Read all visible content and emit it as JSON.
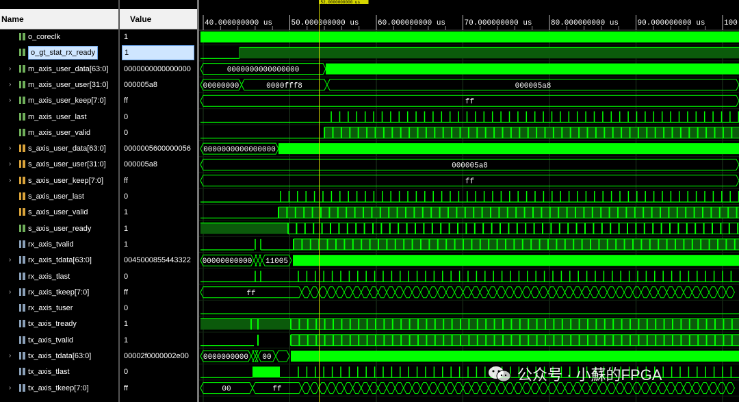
{
  "header": {
    "name_label": "Name",
    "value_label": "Value"
  },
  "cursor_label": "52.0000000000 us",
  "time_ticks": [
    "40.000000000 us",
    "50.000000000 us",
    "60.000000000 us",
    "70.000000000 us",
    "80.000000000 us",
    "90.000000000 us",
    "100."
  ],
  "signals": [
    {
      "name": "o_coreclk",
      "value": "1",
      "type": "bit",
      "expand": false
    },
    {
      "name": "o_gt_stat_rx_ready",
      "value": "1",
      "type": "bit",
      "expand": false,
      "selected": true
    },
    {
      "name": "m_axis_user_data[63:0]",
      "value": "0000000000000000",
      "type": "bus",
      "expand": true
    },
    {
      "name": "m_axis_user_user[31:0]",
      "value": "000005a8",
      "type": "bus",
      "expand": true
    },
    {
      "name": "m_axis_user_keep[7:0]",
      "value": "ff",
      "type": "bus",
      "expand": true
    },
    {
      "name": "m_axis_user_last",
      "value": "0",
      "type": "bit",
      "expand": false
    },
    {
      "name": "m_axis_user_valid",
      "value": "0",
      "type": "bit",
      "expand": false
    },
    {
      "name": "s_axis_user_data[63:0]",
      "value": "0000005600000056",
      "type": "bus",
      "expand": true,
      "icon": "orange"
    },
    {
      "name": "s_axis_user_user[31:0]",
      "value": "000005a8",
      "type": "bus",
      "expand": true,
      "icon": "orange"
    },
    {
      "name": "s_axis_user_keep[7:0]",
      "value": "ff",
      "type": "bus",
      "expand": true,
      "icon": "orange"
    },
    {
      "name": "s_axis_user_last",
      "value": "0",
      "type": "bit",
      "expand": false,
      "icon": "orange"
    },
    {
      "name": "s_axis_user_valid",
      "value": "1",
      "type": "bit",
      "expand": false,
      "icon": "orange"
    },
    {
      "name": "s_axis_user_ready",
      "value": "1",
      "type": "bit",
      "expand": false
    },
    {
      "name": "rx_axis_tvalid",
      "value": "1",
      "type": "bit",
      "expand": false,
      "icon": "io"
    },
    {
      "name": "rx_axis_tdata[63:0]",
      "value": "0045000855443322",
      "type": "bus",
      "expand": true,
      "icon": "io"
    },
    {
      "name": "rx_axis_tlast",
      "value": "0",
      "type": "bit",
      "expand": false,
      "icon": "io"
    },
    {
      "name": "rx_axis_tkeep[7:0]",
      "value": "ff",
      "type": "bus",
      "expand": true,
      "icon": "io"
    },
    {
      "name": "rx_axis_tuser",
      "value": "0",
      "type": "bit",
      "expand": false,
      "icon": "io"
    },
    {
      "name": "tx_axis_tready",
      "value": "1",
      "type": "bit",
      "expand": false,
      "icon": "io"
    },
    {
      "name": "tx_axis_tvalid",
      "value": "1",
      "type": "bit",
      "expand": false,
      "icon": "io"
    },
    {
      "name": "tx_axis_tdata[63:0]",
      "value": "00002f0000002e00",
      "type": "bus",
      "expand": true,
      "icon": "io"
    },
    {
      "name": "tx_axis_tlast",
      "value": "0",
      "type": "bit",
      "expand": false,
      "icon": "io"
    },
    {
      "name": "tx_axis_tkeep[7:0]",
      "value": "ff",
      "type": "bus",
      "expand": true,
      "icon": "io"
    }
  ],
  "wave_labels": {
    "m_data_pre": "0000000000000000",
    "m_user_a": "00000000",
    "m_user_b": "0000fff8",
    "m_user_c": "000005a8",
    "m_keep": "ff",
    "s_data_pre": "0000000000000000",
    "s_user": "000005a8",
    "s_keep": "ff",
    "rx_tdata_a": "00000000000",
    "rx_tdata_b": "11005",
    "rx_tkeep": "ff",
    "tx_tdata_a": "0000000000",
    "tx_tdata_b": "00",
    "tx_tkeep_a": "00",
    "tx_tkeep_b": "ff"
  },
  "watermark": {
    "text": "公众号 · 小蘇的FPGA"
  },
  "colors": {
    "wave": "#00ff00",
    "bus_fill": "#00ff00",
    "cursor": "#d6d600",
    "grid": "#1e3a1e"
  }
}
